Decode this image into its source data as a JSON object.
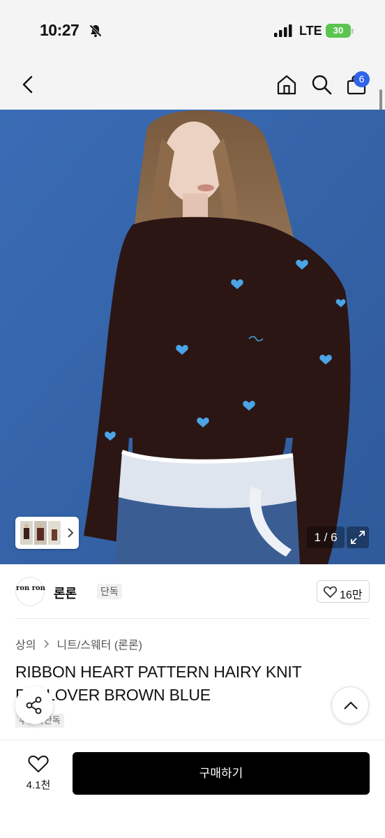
{
  "status_bar": {
    "time": "10:27",
    "network": "LTE",
    "battery": "30"
  },
  "nav": {
    "cart_count": "6"
  },
  "gallery": {
    "counter": "1 / 6"
  },
  "brand": {
    "logo_text": "ron ron",
    "name": "론론",
    "tag": "단독",
    "like_count": "16만"
  },
  "breadcrumb": {
    "items": [
      "상의",
      "니트/스웨터 (론론)"
    ]
  },
  "product": {
    "title": "RIBBON HEART PATTERN HAIRY KNIT PULLOVER BROWN BLUE",
    "tags": "무신사단독"
  },
  "bottom_bar": {
    "wish_count": "4.1천",
    "buy_label": "구매하기"
  },
  "colors": {
    "background_blue": "#3f70b4",
    "sweater_brown": "#2b1614",
    "badge_blue": "#2f63e8",
    "battery_green": "#5cc451"
  },
  "icons": [
    "bell-slash-icon",
    "signal-icon",
    "back-icon",
    "home-icon",
    "search-icon",
    "bag-icon",
    "chevron-right-icon",
    "expand-icon",
    "heart-icon",
    "share-icon",
    "chevron-up-icon"
  ]
}
